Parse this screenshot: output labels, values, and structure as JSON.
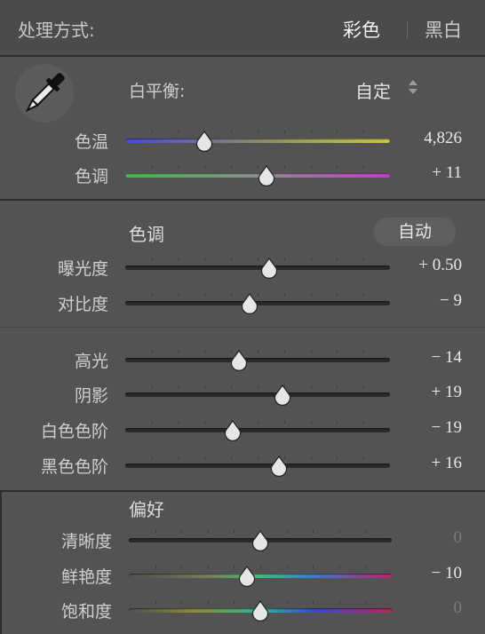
{
  "header": {
    "title": "处理方式:",
    "option_color": "彩色",
    "option_bw": "黑白"
  },
  "white_balance": {
    "label": "白平衡:",
    "value": "自定"
  },
  "temp_tint": [
    {
      "label": "色温",
      "value": "4,826",
      "position": 0.3,
      "track": "linear-gradient(90deg,#4a4ad8,#8a8a6a,#c8c848)"
    },
    {
      "label": "色调",
      "value": "+ 11",
      "position": 0.535,
      "track": "linear-gradient(90deg,#3fb84a,#8c8c8c,#c63ecb)"
    }
  ],
  "tone": {
    "title": "色调",
    "auto_label": "自动",
    "group1": [
      {
        "label": "曝光度",
        "value": "+ 0.50",
        "position": 0.545
      },
      {
        "label": "对比度",
        "value": "− 9",
        "position": 0.47
      }
    ],
    "group2": [
      {
        "label": "高光",
        "value": "− 14",
        "position": 0.43
      },
      {
        "label": "阴影",
        "value": "+ 19",
        "position": 0.595
      },
      {
        "label": "白色色阶",
        "value": "− 19",
        "position": 0.405
      },
      {
        "label": "黑色色阶",
        "value": "+ 16",
        "position": 0.58
      }
    ]
  },
  "presence": {
    "title": "偏好",
    "rows": [
      {
        "label": "清晰度",
        "value": "0",
        "dim": true,
        "position": 0.5,
        "track": ""
      },
      {
        "label": "鲜艳度",
        "value": "− 10",
        "dim": false,
        "position": 0.45,
        "track": "linear-gradient(90deg,#505050,#7a7a5a 30%,#3cbf7a 50%,#3a7ad0 70%,#c0206a 100%)"
      },
      {
        "label": "饱和度",
        "value": "0",
        "dim": true,
        "position": 0.5,
        "track": "linear-gradient(90deg,#505050,#8a8a3a 25%,#2ab88a 50%,#3a4ad0 70%,#c02060 100%)"
      }
    ]
  },
  "colors": {
    "panel_bg": "#535353",
    "text": "#cfcfcf",
    "value_text": "#e8e8e8",
    "dim_value": "#7c7c7c"
  }
}
